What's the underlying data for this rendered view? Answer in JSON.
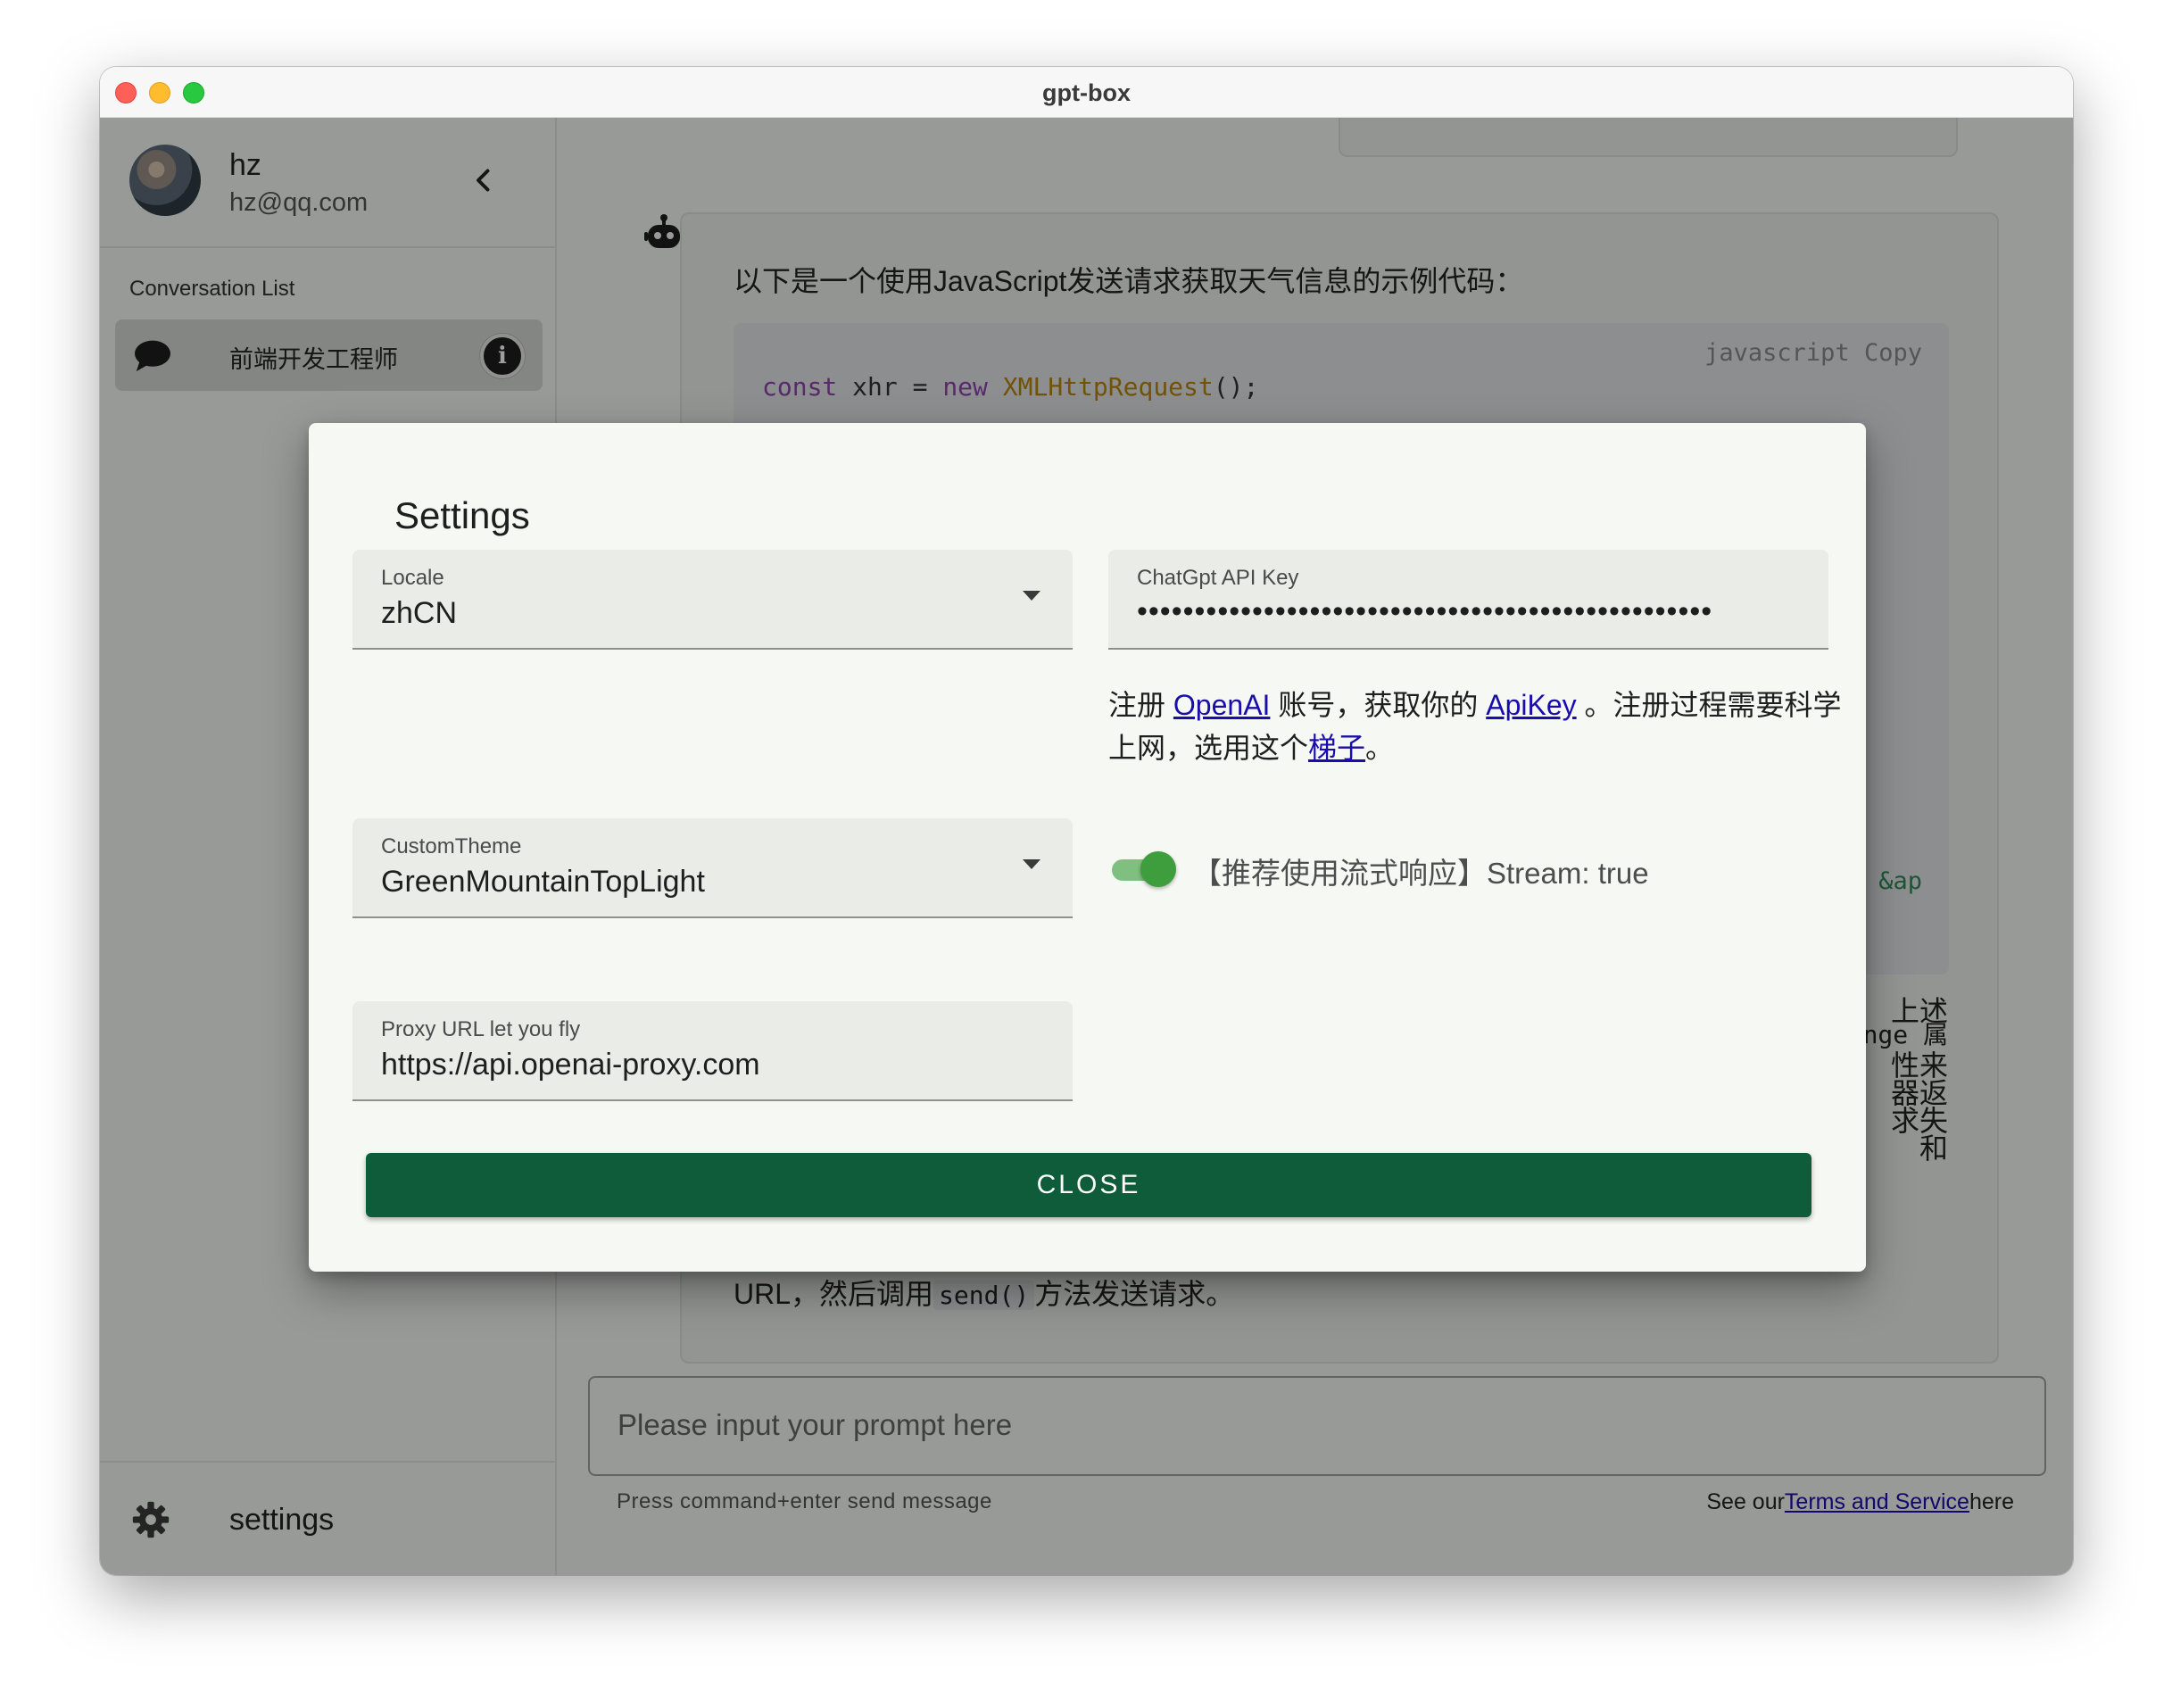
{
  "window": {
    "title": "gpt-box"
  },
  "sidebar": {
    "user": {
      "name": "hz",
      "email": "hz@qq.com"
    },
    "conversation_heading": "Conversation List",
    "conversations": [
      {
        "label": "前端开发工程师"
      }
    ],
    "settings_label": "settings"
  },
  "chat": {
    "intro": "以下是一个使用JavaScript发送请求获取天气信息的示例代码：",
    "code_lang": "javascript",
    "code_copy": "Copy",
    "code_frag": "&ap",
    "side_lines": [
      "上述",
      "nge 属",
      "性来",
      "器返",
      "求失",
      "和"
    ],
    "final_prefix": "URL，然后调用",
    "final_code": "send()",
    "final_suffix": "方法发送请求。"
  },
  "composer": {
    "placeholder": "Please input your prompt here",
    "hint": "Press command+enter send message",
    "terms_prefix": "See our",
    "terms_link": "Terms and Service",
    "terms_suffix": "here"
  },
  "dialog": {
    "title": "Settings",
    "locale": {
      "label": "Locale",
      "value": "zhCN"
    },
    "api_key": {
      "label": "ChatGpt API Key",
      "masked": "••••••••••••••••••••••••••••••••••••••••••••••••••"
    },
    "info": {
      "part1": "注册",
      "link1": "OpenAI",
      "part2": "账号，获取你的",
      "link2": "ApiKey",
      "part3": "。注册过程需要科学上网，选用这个",
      "link3": "梯子",
      "part4": "。"
    },
    "theme": {
      "label": "CustomTheme",
      "value": "GreenMountainTopLight"
    },
    "stream": {
      "label": "【推荐使用流式响应】Stream: true",
      "enabled": true
    },
    "proxy": {
      "label": "Proxy URL let you fly",
      "value": "https://api.openai-proxy.com"
    },
    "close_label": "CLOSE"
  },
  "colors": {
    "primary": "#0f5c3a",
    "toggle_on": "#3e9e3e",
    "link": "#1a0dab",
    "scrim": "rgba(0,0,0,0.38)"
  }
}
